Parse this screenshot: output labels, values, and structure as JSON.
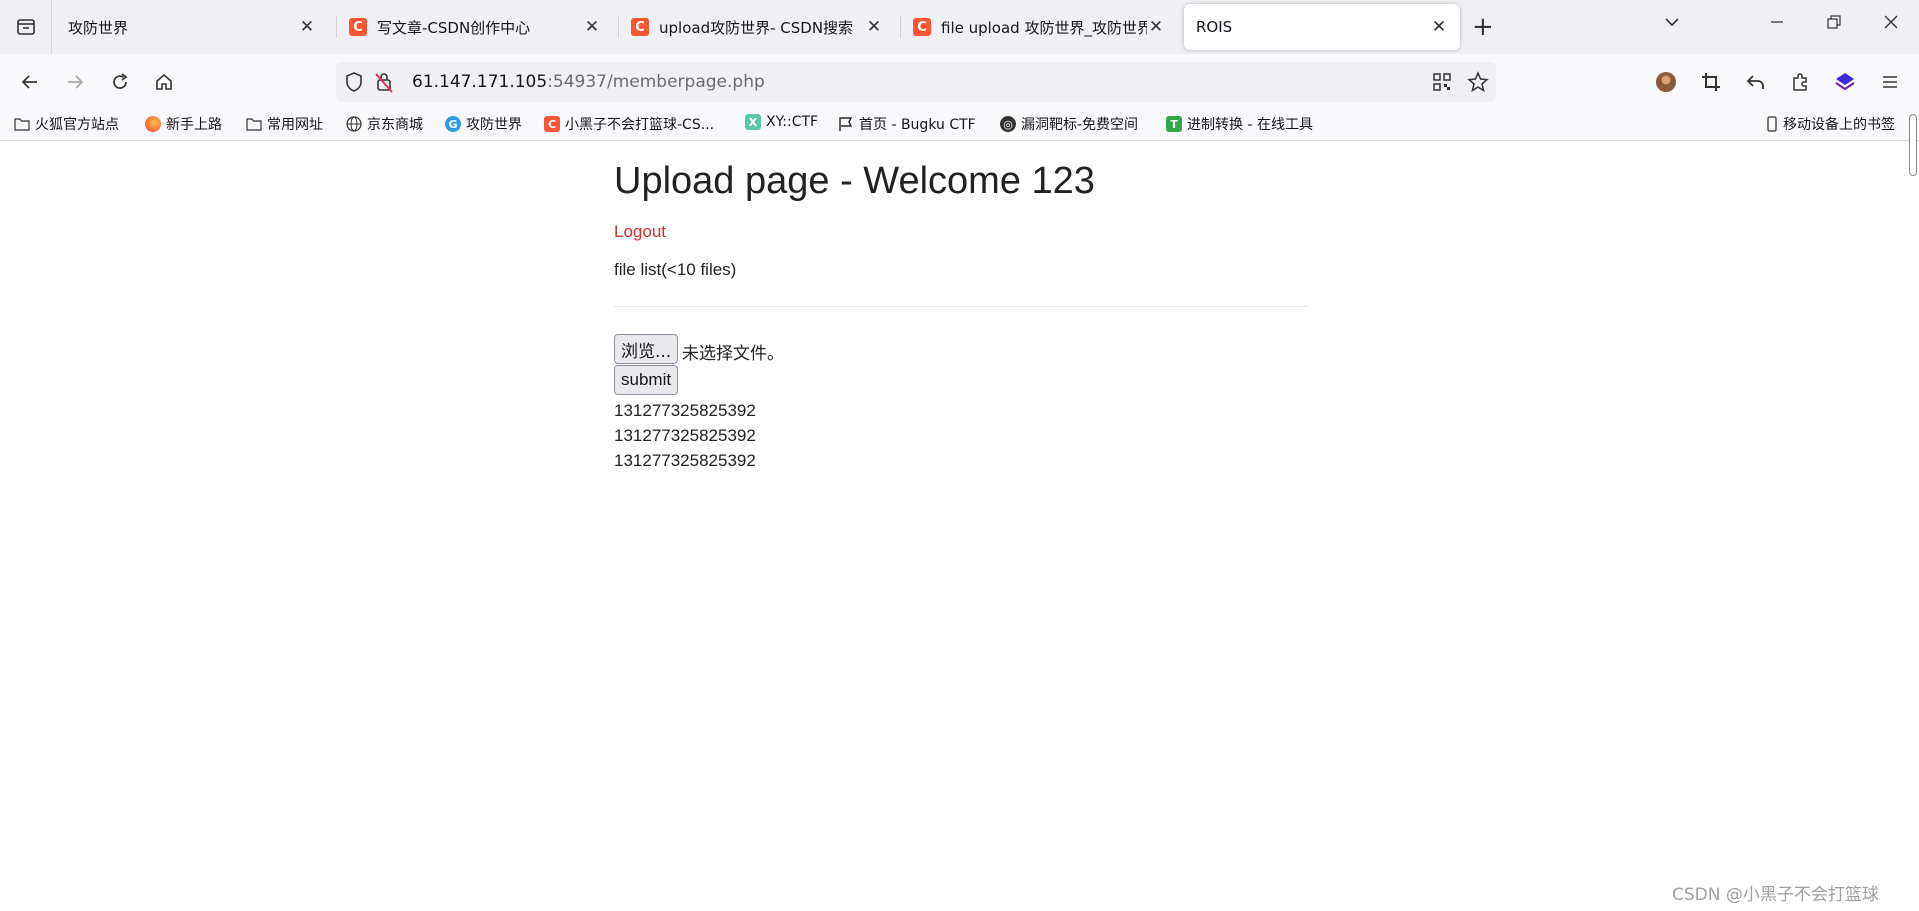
{
  "tabs": [
    {
      "title": "攻防世界",
      "favicon": "none"
    },
    {
      "title": "写文章-CSDN创作中心",
      "favicon": "csdn-icon"
    },
    {
      "title": "upload攻防世界- CSDN搜索",
      "favicon": "csdn-icon"
    },
    {
      "title": "file upload 攻防世界_攻防世界",
      "favicon": "csdn-icon"
    },
    {
      "title": "ROIS",
      "favicon": "none",
      "active": true
    }
  ],
  "address_bar": {
    "host": "61.147.171.105",
    "rest": ":54937/memberpage.php"
  },
  "bookmarks": [
    {
      "label": "火狐官方站点",
      "icon": "folder-icon"
    },
    {
      "label": "新手上路",
      "icon": "firefox-icon"
    },
    {
      "label": "常用网址",
      "icon": "folder-icon"
    },
    {
      "label": "京东商城",
      "icon": "globe-icon"
    },
    {
      "label": "攻防世界",
      "icon": "adworld-icon"
    },
    {
      "label": "小黑子不会打篮球-CS...",
      "icon": "csdn-icon"
    },
    {
      "label": "XY::CTF",
      "icon": "xyctf-icon"
    },
    {
      "label": "首页 - Bugku CTF",
      "icon": "flag-icon"
    },
    {
      "label": "漏洞靶标-免费空间",
      "icon": "bug-icon"
    },
    {
      "label": "进制转换 - 在线工具",
      "icon": "tool-icon"
    },
    {
      "label": "移动设备上的书签",
      "icon": "mobile-icon"
    }
  ],
  "page": {
    "title": "Upload page - Welcome 123",
    "logout": "Logout",
    "file_list_label": "file list(<10 files)",
    "browse_label": "浏览...",
    "no_file_label": "未选择文件。",
    "submit_label": "submit",
    "files": [
      "131277325825392",
      "131277325825392",
      "131277325825392"
    ]
  },
  "watermark": "CSDN @小黑子不会打篮球",
  "colors": {
    "accent_link": "#dc2b2b",
    "csdn_brand": "#fc5531",
    "tabstrip_bg": "#f0f0f4"
  }
}
